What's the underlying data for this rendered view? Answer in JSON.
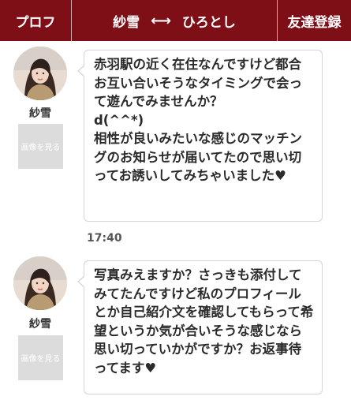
{
  "header": {
    "left_label": "プロフ",
    "partner_name": "紗雪",
    "arrow": "⟷",
    "user_name": "ひろとし",
    "right_label": "友達登録",
    "bar_color": "#7f0f16"
  },
  "messages": [
    {
      "sender": "紗雪",
      "avatar_icon": "profile-photo",
      "photo_button": "画像を見る",
      "text": "赤羽駅の近く在住なんですけど都合お互い合いそうなタイミングで会って遊んでみませんか？\nd(^^*)\n相性が良いみたいな感じのマッチングのお知らせが届いてたので思い切ってお誘いしてみちゃいました♥",
      "time": "17:40"
    },
    {
      "sender": "紗雪",
      "avatar_icon": "profile-photo",
      "photo_button": "画像を見る",
      "text": "写真みえますか？さっきも添付してみてたんですけど私のプロフィールとか自己紹介文を確認してもらって希望というか気が合いそうな感じなら思い切っていかがですか？お返事待ってます♥"
    }
  ]
}
